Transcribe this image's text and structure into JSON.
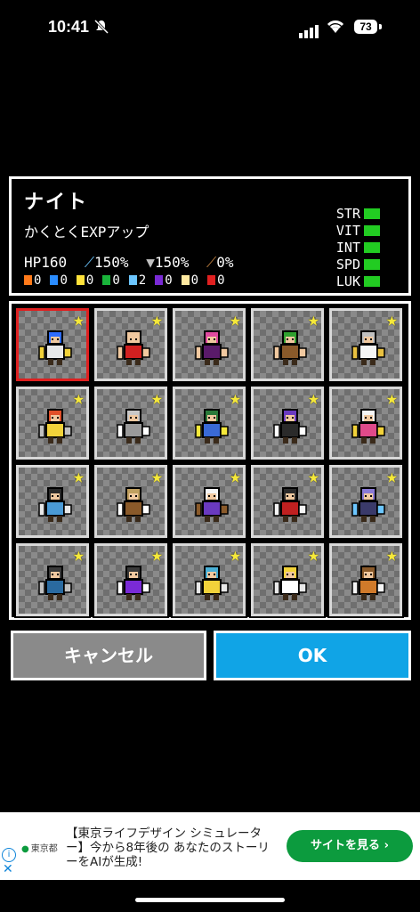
{
  "status": {
    "time": "10:41",
    "battery": "73"
  },
  "character": {
    "name": "ナイト",
    "skill": "かくとくEXPアップ",
    "stats": [
      {
        "icon": "hp",
        "text": "HP160"
      },
      {
        "icon": "sword-icon",
        "text": "150%"
      },
      {
        "icon": "shield-icon",
        "text": "150%"
      },
      {
        "icon": "bow-icon",
        "text": "0%"
      }
    ],
    "elements": [
      {
        "name": "fire",
        "value": "0",
        "color": "#ff7a1a"
      },
      {
        "name": "water",
        "value": "0",
        "color": "#2a8cff"
      },
      {
        "name": "thunder",
        "value": "0",
        "color": "#ffe23a"
      },
      {
        "name": "wind",
        "value": "0",
        "color": "#19b43a"
      },
      {
        "name": "ice",
        "value": "2",
        "color": "#6cc6ff"
      },
      {
        "name": "dark",
        "value": "0",
        "color": "#7a2ad6"
      },
      {
        "name": "light",
        "value": "0",
        "color": "#ffe9a0"
      },
      {
        "name": "holy",
        "value": "0",
        "color": "#e02020"
      }
    ],
    "abilities": [
      "STR",
      "VIT",
      "INT",
      "SPD",
      "LUK"
    ]
  },
  "grid": {
    "characters": [
      {
        "name": "knight",
        "colors": [
          "#2d6cff",
          "#e8e8e8",
          "#f2d23a"
        ]
      },
      {
        "name": "villager",
        "colors": [
          "#f1c9a0",
          "#d22020",
          "#f1c9a0"
        ]
      },
      {
        "name": "dancer",
        "colors": [
          "#e04aa0",
          "#5a1a6a",
          "#f1c9a0"
        ]
      },
      {
        "name": "archer",
        "colors": [
          "#2fa02f",
          "#8a5a2a",
          "#f1c9a0"
        ]
      },
      {
        "name": "scholar",
        "colors": [
          "#c0c0c0",
          "#f5f5f5",
          "#e8c040"
        ]
      },
      {
        "name": "warrior",
        "colors": [
          "#e0502a",
          "#f2d23a",
          "#c0c0c0"
        ]
      },
      {
        "name": "armored",
        "colors": [
          "#c8c8c8",
          "#9a9a9a",
          "#ffffff"
        ]
      },
      {
        "name": "mage",
        "colors": [
          "#2a7a3a",
          "#3a6ad6",
          "#f5e83a"
        ]
      },
      {
        "name": "ninja",
        "colors": [
          "#6a3ac0",
          "#2a2a2a",
          "#ffffff"
        ]
      },
      {
        "name": "bunny",
        "colors": [
          "#f5f5f5",
          "#e04a8a",
          "#f2d23a"
        ]
      },
      {
        "name": "swordsman",
        "colors": [
          "#2a2a2a",
          "#4a9ad6",
          "#e8e8e8"
        ]
      },
      {
        "name": "beast",
        "colors": [
          "#c0a060",
          "#8a5a2a",
          "#ffffff"
        ]
      },
      {
        "name": "skull",
        "colors": [
          "#f5f5f5",
          "#6a3ac0",
          "#8a5a2a"
        ]
      },
      {
        "name": "vampire",
        "colors": [
          "#2a2a2a",
          "#c02020",
          "#f5f5f5"
        ]
      },
      {
        "name": "gunner",
        "colors": [
          "#8a7ad6",
          "#3a3a6a",
          "#6cc6ff"
        ]
      },
      {
        "name": "rogue",
        "colors": [
          "#3a3a3a",
          "#2a6aa0",
          "#c0c0c0"
        ]
      },
      {
        "name": "dark-knight",
        "colors": [
          "#3a3a3a",
          "#7a2ad6",
          "#ffffff"
        ]
      },
      {
        "name": "cleric",
        "colors": [
          "#4ab0d6",
          "#f2d23a",
          "#e8e8e8"
        ]
      },
      {
        "name": "fencer",
        "colors": [
          "#f2d23a",
          "#ffffff",
          "#e8e8e8"
        ]
      },
      {
        "name": "gambler",
        "colors": [
          "#8a5a2a",
          "#d07a2a",
          "#f5f5f5"
        ]
      }
    ]
  },
  "buttons": {
    "cancel": "キャンセル",
    "ok": "OK"
  },
  "ad": {
    "advertiser": "東京都",
    "text": "【東京ライフデザイン シミュレーター】今から8年後の あなたのストーリーをAIが生成!",
    "cta": "サイトを見る ›"
  }
}
